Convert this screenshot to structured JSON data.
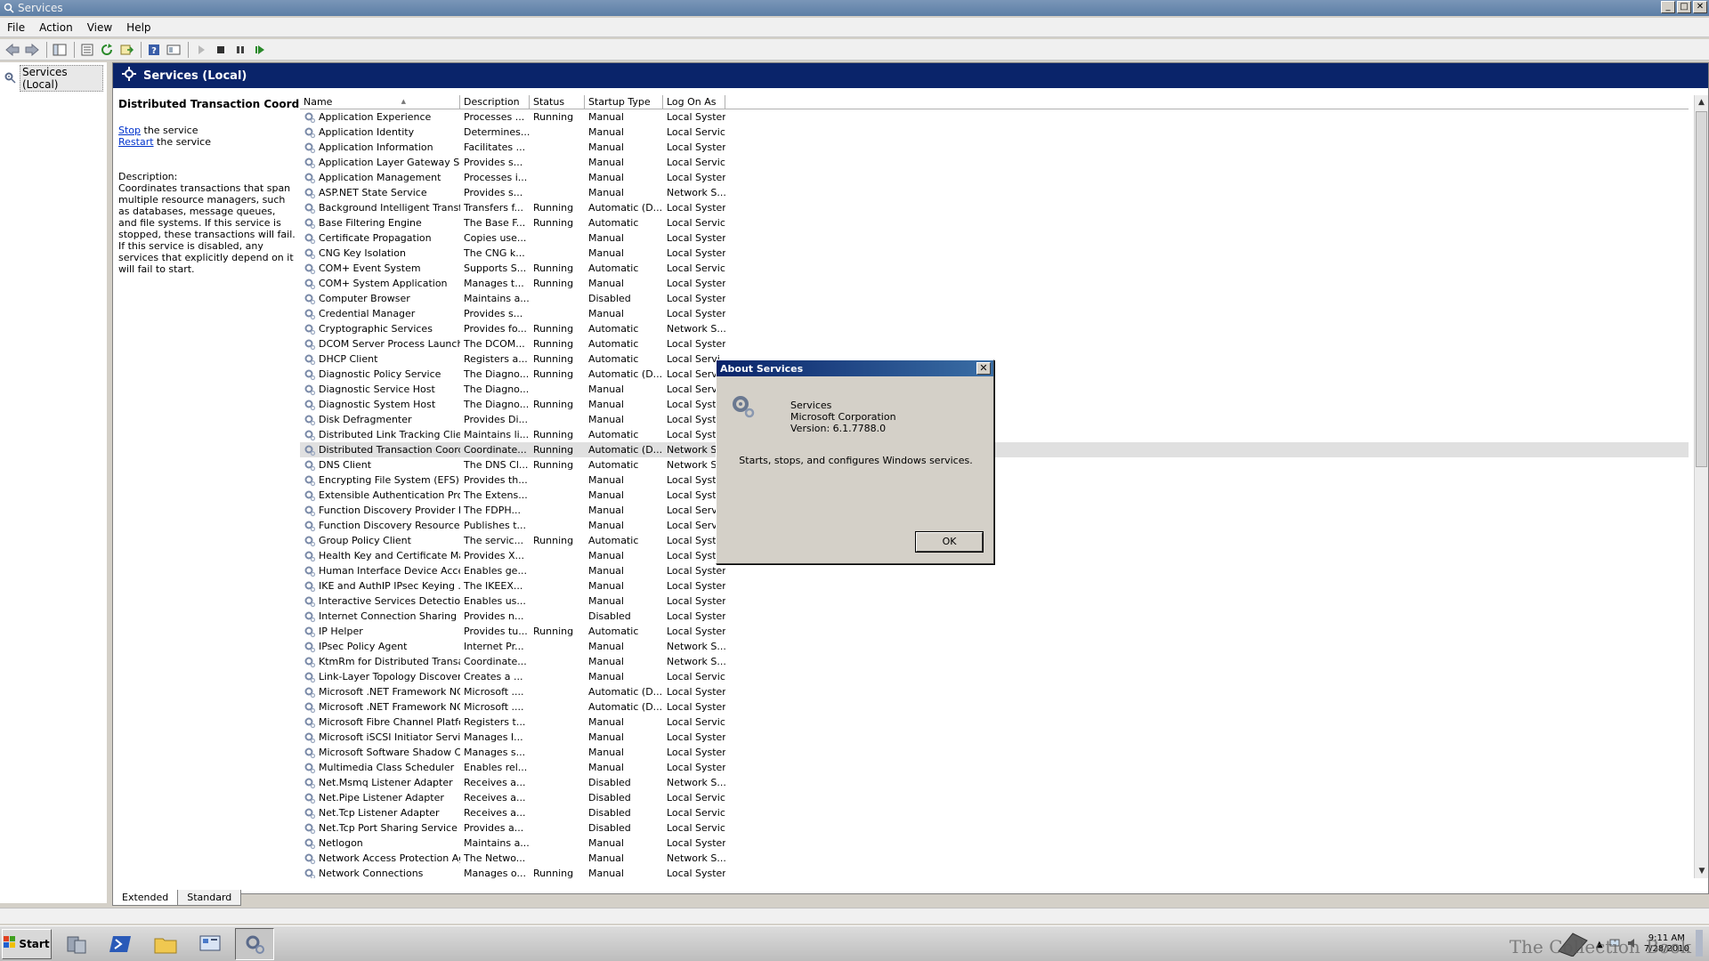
{
  "window": {
    "title": "Services",
    "controls": [
      "_",
      "□",
      "✕"
    ]
  },
  "menu": [
    "File",
    "Action",
    "View",
    "Help"
  ],
  "tree": {
    "root_label": "Services (Local)"
  },
  "main": {
    "header_title": "Services (Local)",
    "selected_service": "Distributed Transaction Coordinator",
    "stop_link": "Stop",
    "stop_suffix": " the service",
    "restart_link": "Restart",
    "restart_suffix": " the service",
    "description_label": "Description:",
    "description_text": "Coordinates transactions that span multiple resource managers, such as databases, message queues, and file systems. If this service is stopped, these transactions will fail. If this service is disabled, any services that explicitly depend on it will fail to start."
  },
  "table": {
    "columns": [
      "Name",
      "Description",
      "Status",
      "Startup Type",
      "Log On As"
    ],
    "sort_indicator": "▲",
    "rows": [
      [
        "Application Experience",
        "Processes ...",
        "Running",
        "Manual",
        "Local System"
      ],
      [
        "Application Identity",
        "Determines...",
        "",
        "Manual",
        "Local Service"
      ],
      [
        "Application Information",
        "Facilitates ...",
        "",
        "Manual",
        "Local System"
      ],
      [
        "Application Layer Gateway Se...",
        "Provides s...",
        "",
        "Manual",
        "Local Service"
      ],
      [
        "Application Management",
        "Processes i...",
        "",
        "Manual",
        "Local System"
      ],
      [
        "ASP.NET State Service",
        "Provides s...",
        "",
        "Manual",
        "Network S..."
      ],
      [
        "Background Intelligent Transf...",
        "Transfers f...",
        "Running",
        "Automatic (D...",
        "Local System"
      ],
      [
        "Base Filtering Engine",
        "The Base F...",
        "Running",
        "Automatic",
        "Local Service"
      ],
      [
        "Certificate Propagation",
        "Copies use...",
        "",
        "Manual",
        "Local System"
      ],
      [
        "CNG Key Isolation",
        "The CNG k...",
        "",
        "Manual",
        "Local System"
      ],
      [
        "COM+ Event System",
        "Supports S...",
        "Running",
        "Automatic",
        "Local Service"
      ],
      [
        "COM+ System Application",
        "Manages t...",
        "Running",
        "Manual",
        "Local System"
      ],
      [
        "Computer Browser",
        "Maintains a...",
        "",
        "Disabled",
        "Local System"
      ],
      [
        "Credential Manager",
        "Provides s...",
        "",
        "Manual",
        "Local System"
      ],
      [
        "Cryptographic Services",
        "Provides fo...",
        "Running",
        "Automatic",
        "Network S..."
      ],
      [
        "DCOM Server Process Launcher",
        "The DCOM...",
        "Running",
        "Automatic",
        "Local System"
      ],
      [
        "DHCP Client",
        "Registers a...",
        "Running",
        "Automatic",
        "Local Servi"
      ],
      [
        "Diagnostic Policy Service",
        "The Diagno...",
        "Running",
        "Automatic (D...",
        "Local Servi"
      ],
      [
        "Diagnostic Service Host",
        "The Diagno...",
        "",
        "Manual",
        "Local Servi"
      ],
      [
        "Diagnostic System Host",
        "The Diagno...",
        "Running",
        "Manual",
        "Local Syste"
      ],
      [
        "Disk Defragmenter",
        "Provides Di...",
        "",
        "Manual",
        "Local Syste"
      ],
      [
        "Distributed Link Tracking Client",
        "Maintains li...",
        "Running",
        "Automatic",
        "Local Syste"
      ],
      [
        "Distributed Transaction Coord...",
        "Coordinate...",
        "Running",
        "Automatic (D...",
        "Network S"
      ],
      [
        "DNS Client",
        "The DNS Cl...",
        "Running",
        "Automatic",
        "Network S"
      ],
      [
        "Encrypting File System (EFS)",
        "Provides th...",
        "",
        "Manual",
        "Local Syste"
      ],
      [
        "Extensible Authentication Pro...",
        "The Extens...",
        "",
        "Manual",
        "Local Syste"
      ],
      [
        "Function Discovery Provider H...",
        "The FDPH...",
        "",
        "Manual",
        "Local Servi"
      ],
      [
        "Function Discovery Resource ...",
        "Publishes t...",
        "",
        "Manual",
        "Local Servi"
      ],
      [
        "Group Policy Client",
        "The servic...",
        "Running",
        "Automatic",
        "Local Syste"
      ],
      [
        "Health Key and Certificate Ma...",
        "Provides X...",
        "",
        "Manual",
        "Local Syste"
      ],
      [
        "Human Interface Device Access",
        "Enables ge...",
        "",
        "Manual",
        "Local System"
      ],
      [
        "IKE and AuthIP IPsec Keying ...",
        "The IKEEX...",
        "",
        "Manual",
        "Local System"
      ],
      [
        "Interactive Services Detection",
        "Enables us...",
        "",
        "Manual",
        "Local System"
      ],
      [
        "Internet Connection Sharing (...",
        "Provides n...",
        "",
        "Disabled",
        "Local System"
      ],
      [
        "IP Helper",
        "Provides tu...",
        "Running",
        "Automatic",
        "Local System"
      ],
      [
        "IPsec Policy Agent",
        "Internet Pr...",
        "",
        "Manual",
        "Network S..."
      ],
      [
        "KtmRm for Distributed Transa...",
        "Coordinate...",
        "",
        "Manual",
        "Network S..."
      ],
      [
        "Link-Layer Topology Discover...",
        "Creates a ...",
        "",
        "Manual",
        "Local Service"
      ],
      [
        "Microsoft .NET Framework NG...",
        "Microsoft ....",
        "",
        "Automatic (D...",
        "Local System"
      ],
      [
        "Microsoft .NET Framework NG...",
        "Microsoft ....",
        "",
        "Automatic (D...",
        "Local System"
      ],
      [
        "Microsoft Fibre Channel Platfo...",
        "Registers t...",
        "",
        "Manual",
        "Local Service"
      ],
      [
        "Microsoft iSCSI Initiator Service",
        "Manages I...",
        "",
        "Manual",
        "Local System"
      ],
      [
        "Microsoft Software Shadow C...",
        "Manages s...",
        "",
        "Manual",
        "Local System"
      ],
      [
        "Multimedia Class Scheduler",
        "Enables rel...",
        "",
        "Manual",
        "Local System"
      ],
      [
        "Net.Msmq Listener Adapter",
        "Receives a...",
        "",
        "Disabled",
        "Network S..."
      ],
      [
        "Net.Pipe Listener Adapter",
        "Receives a...",
        "",
        "Disabled",
        "Local Service"
      ],
      [
        "Net.Tcp Listener Adapter",
        "Receives a...",
        "",
        "Disabled",
        "Local Service"
      ],
      [
        "Net.Tcp Port Sharing Service",
        "Provides a...",
        "",
        "Disabled",
        "Local Service"
      ],
      [
        "Netlogon",
        "Maintains a...",
        "",
        "Manual",
        "Local System"
      ],
      [
        "Network Access Protection Ag...",
        "The Netwo...",
        "",
        "Manual",
        "Network S..."
      ],
      [
        "Network Connections",
        "Manages o...",
        "Running",
        "Manual",
        "Local System"
      ]
    ],
    "selected_row_index": 22
  },
  "tabs": [
    "Extended",
    "Standard"
  ],
  "taskbar": {
    "start_label": "Start",
    "clock_time": "9:11 AM",
    "clock_date": "7/28/2010"
  },
  "watermark": "The Collection Book",
  "dialog": {
    "title": "About Services",
    "app_name": "Services",
    "company": "Microsoft Corporation",
    "version": "Version: 6.1.7788.0",
    "message": "Starts, stops, and configures Windows services.",
    "ok_label": "OK"
  },
  "colors": {
    "header_blue": "#0a246a",
    "link": "#0033cc",
    "selection": "#e0e0e0"
  }
}
